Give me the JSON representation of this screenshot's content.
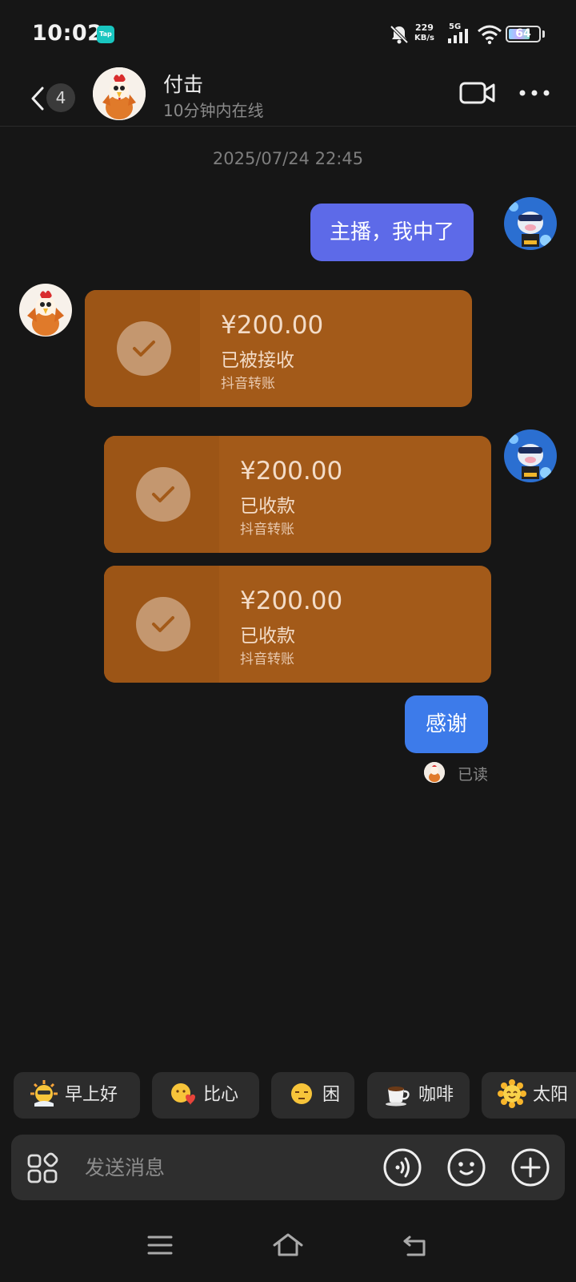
{
  "status_bar": {
    "time": "10:02",
    "tap_badge": "Tap",
    "net_speed_value": "229",
    "net_speed_unit": "KB/s",
    "network": "5G",
    "battery": "64"
  },
  "header": {
    "unread_count": "4",
    "contact_name": "付击",
    "contact_status": "10分钟内在线"
  },
  "conversation": {
    "timestamp": "2025/07/24 22:45",
    "msg1": "主播，我中了",
    "transfer1": {
      "amount": "¥200.00",
      "state": "已被接收",
      "source": "抖音转账"
    },
    "transfer2": {
      "amount": "¥200.00",
      "state": "已收款",
      "source": "抖音转账"
    },
    "transfer3": {
      "amount": "¥200.00",
      "state": "已收款",
      "source": "抖音转账"
    },
    "msg2": "感谢",
    "read_label": "已读"
  },
  "quick_replies": [
    {
      "label": "早上好",
      "icon": "sun-with-sunglasses-emoji"
    },
    {
      "label": "比心",
      "icon": "heart-hands-emoji"
    },
    {
      "label": "困",
      "icon": "sleepy-face-emoji"
    },
    {
      "label": "咖啡",
      "icon": "coffee-cup-emoji"
    },
    {
      "label": "太阳",
      "icon": "smiling-sun-emoji"
    }
  ],
  "input": {
    "placeholder": "发送消息"
  },
  "colors": {
    "background": "#161616",
    "bubble_purple": "#5d6ae8",
    "bubble_blue": "#3d7bea",
    "transfer_card": "#a35a19"
  }
}
